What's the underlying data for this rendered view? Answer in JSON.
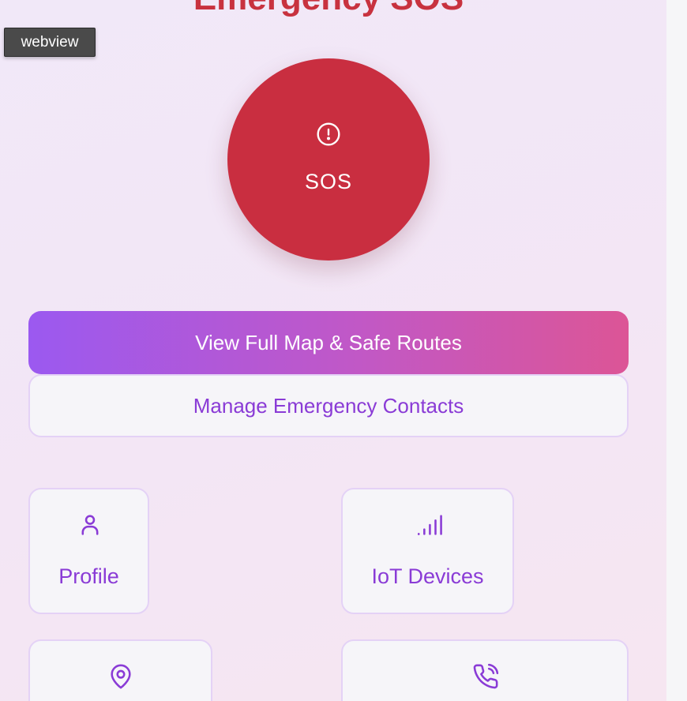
{
  "header": {
    "title": "Emergency SOS",
    "webview_badge": "webview"
  },
  "sos": {
    "label": "SOS",
    "icon": "alert-circle-icon",
    "color": "#c92e40"
  },
  "actions": {
    "map_label": "View Full Map & Safe Routes",
    "contacts_label": "Manage Emergency Contacts"
  },
  "tiles": [
    {
      "label": "Profile",
      "icon": "user-icon"
    },
    {
      "label": "IoT Devices",
      "icon": "signal-icon"
    },
    {
      "label": "",
      "icon": "map-pin-icon"
    },
    {
      "label": "",
      "icon": "phone-call-icon"
    }
  ],
  "colors": {
    "accent_purple": "#8a3bd6",
    "gradient_start": "#9b59f0",
    "gradient_end": "#dc5596",
    "title_red": "#c8323f"
  }
}
